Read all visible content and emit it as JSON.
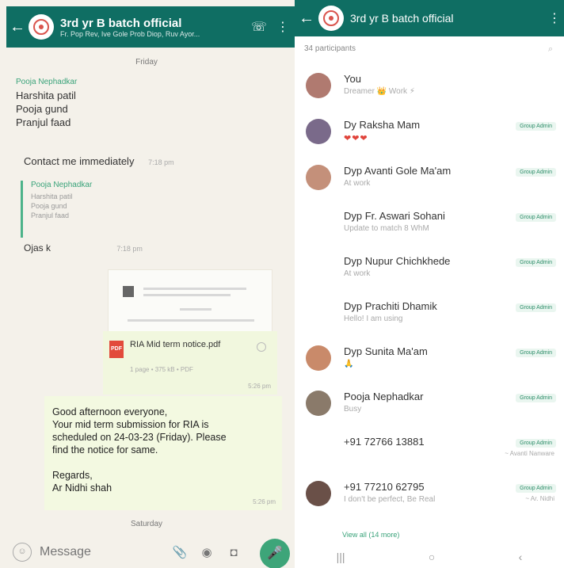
{
  "chat": {
    "header": {
      "title": "3rd yr B batch official",
      "subtitle": "Fr. Pop Rev, Ive Gole Prob Diop, Ruv Ayor..."
    },
    "day_friday": "Friday",
    "message1": {
      "sender": "Pooja Nephadkar",
      "lines": [
        "Harshita patil",
        "Pooja gund",
        "Pranjul faad"
      ]
    },
    "contact_me": "Contact me immediately",
    "contact_time": "7:18 pm",
    "quote": {
      "sender": "Pooja Nephadkar",
      "lines": [
        "Harshita patil",
        "Pooja gund",
        "Pranjul faad"
      ]
    },
    "ojas": "Ojas k",
    "ojas_time": "7:18 pm",
    "pdf": {
      "icon_text": "PDF",
      "name": "RIA Mid term notice.pdf",
      "meta": "1 page • 375 kB • PDF",
      "time": "5:26 pm"
    },
    "notice": {
      "l1": "Good afternoon everyone,",
      "l2": "Your mid term submission for RIA is",
      "l3": "scheduled on 24-03-23 (Friday). Please",
      "l4": "find the notice for same.",
      "l5": "Regards,",
      "l6": "Ar Nidhi shah",
      "time": "5:26 pm"
    },
    "day_saturday": "Saturday",
    "input": {
      "placeholder": "Message"
    }
  },
  "info": {
    "header": {
      "title": "3rd yr B batch official"
    },
    "participants": "34 participants",
    "members": [
      {
        "name": "You",
        "status": "Dreamer 👑 Work ⚡",
        "badge": "",
        "sub": ""
      },
      {
        "name": "Dy Raksha Mam",
        "status": "❤❤❤",
        "badge": "Group Admin",
        "sub": ""
      },
      {
        "name": "Dyp Avanti Gole Ma'am",
        "status": "At work",
        "badge": "Group Admin",
        "sub": ""
      },
      {
        "name": "Dyp Fr. Aswari Sohani",
        "status": "Update to match 8 WhM",
        "badge": "Group Admin",
        "sub": ""
      },
      {
        "name": "Dyp Nupur Chichkhede",
        "status": "At work",
        "badge": "Group Admin",
        "sub": ""
      },
      {
        "name": "Dyp Prachiti Dhamik",
        "status": "Hello! I am using",
        "badge": "Group Admin",
        "sub": ""
      },
      {
        "name": "Dyp Sunita Ma'am",
        "status": "🙏",
        "badge": "Group Admin",
        "sub": ""
      },
      {
        "name": "Pooja Nephadkar",
        "status": "Busy",
        "badge": "Group Admin",
        "sub": ""
      },
      {
        "name": "+91 72766 13881",
        "status": "",
        "badge": "Group Admin",
        "sub": "~ Avanti Nanware"
      },
      {
        "name": "+91 77210 62795",
        "status": "I don't be perfect, Be Real",
        "badge": "Group Admin",
        "sub": "~ Ar. Nidhi"
      }
    ],
    "view_all": "View all (14 more)"
  }
}
